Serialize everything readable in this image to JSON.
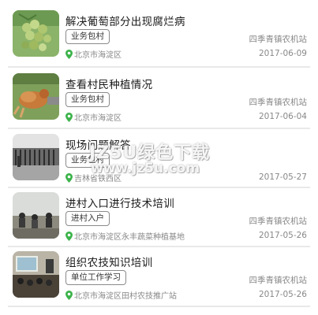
{
  "items": [
    {
      "title": "解决葡萄部分出现腐烂病",
      "tag": "业务包村",
      "org": "四季青镇农机站",
      "location": "北京市海淀区",
      "date": "2017-06-09",
      "thumb_subject": "grapes"
    },
    {
      "title": "查看村民种植情况",
      "tag": "业务包村",
      "org": "四季青镇农机站",
      "location": "北京市海淀区",
      "date": "2017-06-04",
      "thumb_subject": "bird-in-grass"
    },
    {
      "title": "现场问题解答",
      "tag": "业务包村",
      "org": "",
      "location": "吉林省铁西区",
      "date": "2017-05-27",
      "thumb_subject": "building-gate"
    },
    {
      "title": "进村入口进行技术培训",
      "tag": "进村入户",
      "org": "四季青镇农机站",
      "location": "北京市海淀区永丰蔬菜种植基地",
      "date": "2017-05-26",
      "thumb_subject": "field-training"
    },
    {
      "title": "组织农技知识培训",
      "tag": "单位工作学习",
      "org": "四季青镇农机站",
      "location": "北京市海淀区田村农技推广站",
      "date": "2017-05-26",
      "thumb_subject": "classroom-training"
    }
  ],
  "watermark": {
    "line1": "JZ5U绿色下载",
    "line2": "www.jz5u.com"
  },
  "colors": {
    "pin": "#3cb34a",
    "tag_border": "#8a8a8a",
    "meta_text": "#888888"
  }
}
